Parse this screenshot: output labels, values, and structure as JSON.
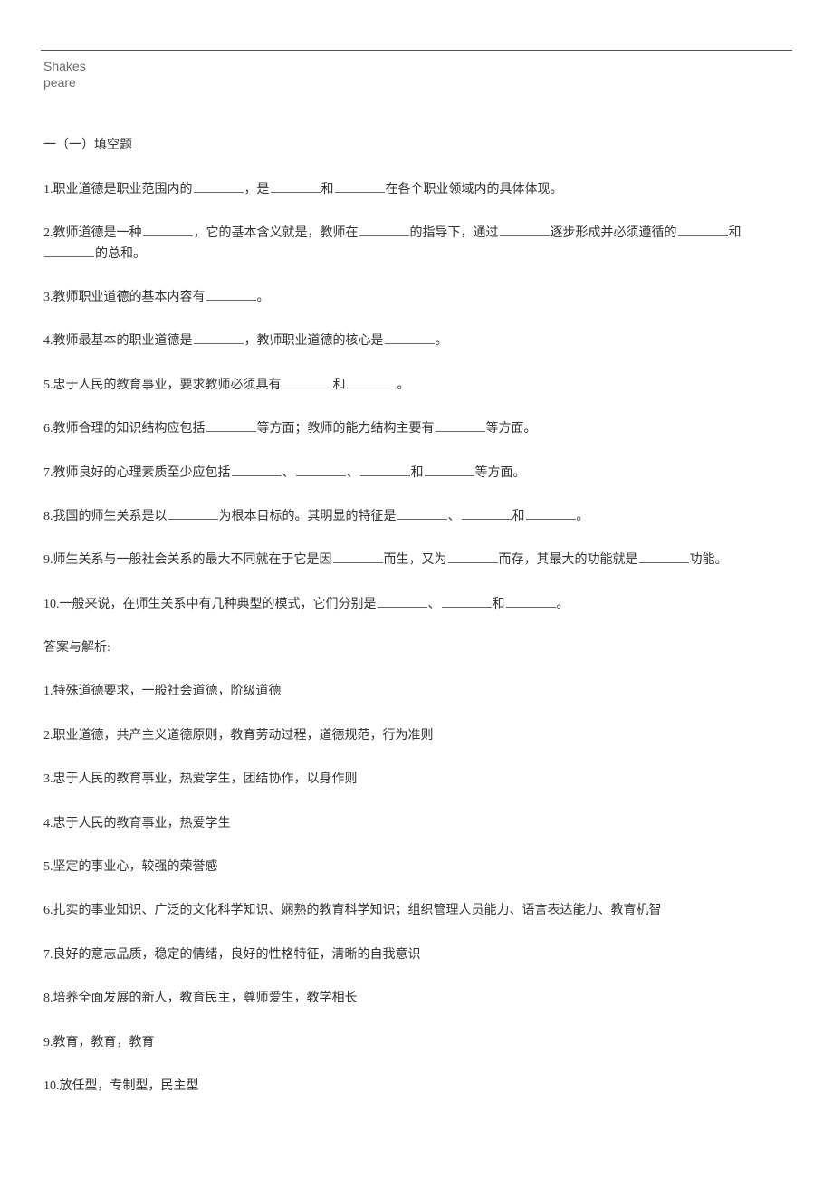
{
  "watermark": "Shakespeare",
  "section_title": "一（一）填空题",
  "questions": [
    {
      "num": "1",
      "parts": [
        "职业道德是职业范围内的",
        "，是",
        "和",
        "在各个职业领域内的具体体现。"
      ],
      "blanks": 3
    },
    {
      "num": "2",
      "parts": [
        "教师道德是一种",
        "，它的基本含义就是，教师在",
        "的指导下，通过",
        "逐步形成并必须遵循的",
        "和",
        "的总和。"
      ],
      "blanks": 5
    },
    {
      "num": "3",
      "parts": [
        "教师职业道德的基本内容有",
        "。"
      ],
      "blanks": 1
    },
    {
      "num": "4",
      "parts": [
        "教师最基本的职业道德是",
        "，教师职业道德的核心是",
        "。"
      ],
      "blanks": 2
    },
    {
      "num": "5",
      "parts": [
        "忠于人民的教育事业，要求教师必须具有",
        "和",
        "。"
      ],
      "blanks": 2
    },
    {
      "num": "6",
      "parts": [
        "教师合理的知识结构应包括",
        "等方面；教师的能力结构主要有",
        "等方面。"
      ],
      "blanks": 2
    },
    {
      "num": "7",
      "parts": [
        "教师良好的心理素质至少应包括",
        "、",
        "、",
        "和",
        "等方面。"
      ],
      "blanks": 4
    },
    {
      "num": "8",
      "parts": [
        "我国的师生关系是以",
        "为根本目标的。其明显的特征是",
        "、",
        "和",
        "。"
      ],
      "blanks": 4
    },
    {
      "num": "9",
      "parts": [
        "师生关系与一般社会关系的最大不同就在于它是因",
        "而生，又为",
        "而存，其最大的功能就是",
        "功能。"
      ],
      "blanks": 3
    },
    {
      "num": "10",
      "parts": [
        "一般来说，在师生关系中有几种典型的模式，它们分别是",
        "、",
        "和",
        "。"
      ],
      "blanks": 3
    }
  ],
  "answer_header": "答案与解析:",
  "answers": [
    {
      "num": "1",
      "text": "特殊道德要求，一般社会道德，阶级道德"
    },
    {
      "num": "2",
      "text": "职业道德，共产主义道德原则，教育劳动过程，道德规范，行为准则"
    },
    {
      "num": "3",
      "text": "忠于人民的教育事业，热爱学生，团结协作，以身作则"
    },
    {
      "num": "4",
      "text": "忠于人民的教育事业，热爱学生"
    },
    {
      "num": "5",
      "text": "坚定的事业心，较强的荣誉感"
    },
    {
      "num": "6",
      "text": "扎实的事业知识、广泛的文化科学知识、娴熟的教育科学知识；组织管理人员能力、语言表达能力、教育机智"
    },
    {
      "num": "7",
      "text": "良好的意志品质，稳定的情绪，良好的性格特征，清晰的自我意识"
    },
    {
      "num": "8",
      "text": "培养全面发展的新人，教育民主，尊师爱生，教学相长"
    },
    {
      "num": "9",
      "text": "教育，教育，教育"
    },
    {
      "num": "10",
      "text": "放任型，专制型，民主型"
    }
  ]
}
